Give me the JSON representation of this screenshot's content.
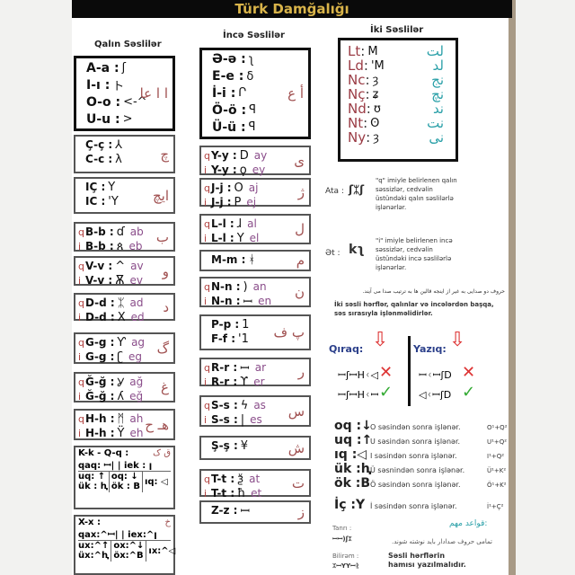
{
  "title": "Türk Damğalığı",
  "headers": {
    "qalin": "Qalın Səslilər",
    "ince": "İncə Səslilər",
    "iki": "İki Səslilər"
  },
  "left_boxes": [
    {
      "thick": true,
      "big": true,
      "lines": [
        {
          "p": "",
          "l": "A-a :",
          "g": "ʃ",
          "s": ""
        },
        {
          "p": "",
          "l": "I-ı  :",
          "g": "ト",
          "s": ""
        },
        {
          "p": "",
          "l": "O-o :",
          "g": "<-^",
          "s": ""
        },
        {
          "p": "",
          "l": "U-u :",
          "g": ">",
          "s": ""
        }
      ],
      "ar": "ا ا عا"
    },
    {
      "lines": [
        {
          "p": "",
          "l": "Ç-ç :",
          "g": "⅄",
          "s": ""
        },
        {
          "p": "",
          "l": "C-c :",
          "g": "λ",
          "s": ""
        }
      ],
      "ar": "چ"
    },
    {
      "lines": [
        {
          "p": "",
          "l": "IÇ :",
          "g": "Y",
          "s": ""
        },
        {
          "p": "",
          "l": "IC :",
          "g": "'Y",
          "s": ""
        }
      ],
      "ar": "ایچ"
    },
    {
      "lines": [
        {
          "p": "q",
          "l": "B-b :",
          "g": "ɗ",
          "s": "ab"
        },
        {
          "p": "i",
          "l": "B-b :",
          "g": "ጰ",
          "s": "eb"
        }
      ],
      "ar": "ب"
    },
    {
      "lines": [
        {
          "p": "q",
          "l": "V-v :",
          "g": "^",
          "s": "av"
        },
        {
          "p": "i",
          "l": "V-v :",
          "g": "Ѫ",
          "s": "ev"
        }
      ],
      "ar": "و"
    },
    {
      "lines": [
        {
          "p": "q",
          "l": "D-d :",
          "g": "ᛯ",
          "s": "ad"
        },
        {
          "p": "i",
          "l": "D-d :",
          "g": "X",
          "s": "ed"
        }
      ],
      "ar": "د"
    },
    {
      "lines": [
        {
          "p": "q",
          "l": "G-g :",
          "g": "Ƴ",
          "s": "ag"
        },
        {
          "p": "i",
          "l": "G-g :",
          "g": "ʗ",
          "s": "eg"
        }
      ],
      "ar": "گ"
    },
    {
      "lines": [
        {
          "p": "q",
          "l": "Ğ-ğ :",
          "g": "Ỿ",
          "s": "ağ"
        },
        {
          "p": "i",
          "l": "Ğ-ğ :",
          "g": "ʎ",
          "s": "eğ"
        }
      ],
      "ar": "غ"
    },
    {
      "lines": [
        {
          "p": "q",
          "l": "H-h :",
          "g": "ᛗ",
          "s": "ah"
        },
        {
          "p": "i",
          "l": "H-h :",
          "g": "Ϋ",
          "s": "eh"
        }
      ],
      "ar": "هـ ح"
    }
  ],
  "kq": {
    "title": "K-k - Q-q :",
    "ar": "ق ک",
    "aq": "qaq: ꟷ|",
    "iek": "iek : ꞁ",
    "uq": "uq: ↑",
    "oq": "oq: ↓",
    "iq": "ıq: ◁",
    "uk": "ük : ⱨ",
    "ok": "ök : B"
  },
  "x": {
    "title": "X-x  :",
    "ar": "خ",
    "ax": "qax:^ꟷ|",
    "iex": "iex:^ꞁ",
    "ux": "ux:^↑",
    "ox": "ox:^↓",
    "ix": "ıx:^◁",
    "uk": "üx:^ⱨ",
    "ok": "öx:^B"
  },
  "mid_boxes": [
    {
      "thick": true,
      "big": true,
      "lines": [
        {
          "p": "",
          "l": "Ə-ə :",
          "g": "ʅ",
          "s": ""
        },
        {
          "p": "",
          "l": "E-e :",
          "g": "ẟ",
          "s": ""
        },
        {
          "p": "",
          "l": "İ-i  :",
          "g": "Ր",
          "s": ""
        },
        {
          "p": "",
          "l": "Ö-ö :",
          "g": "ꟼ",
          "s": ""
        },
        {
          "p": "",
          "l": "Ü-ü :",
          "g": "ꟼ",
          "s": ""
        }
      ],
      "ar": "أ ع"
    },
    {
      "lines": [
        {
          "p": "q",
          "l": "Y-y :",
          "g": "D",
          "s": "ay"
        },
        {
          "p": "i",
          "l": "Y-y :",
          "g": "ϙ",
          "s": "ey"
        }
      ],
      "ar": "ی"
    },
    {
      "lines": [
        {
          "p": "q",
          "l": "J-j  :",
          "g": "O",
          "s": "aj"
        },
        {
          "p": "i",
          "l": "J-j  :",
          "g": "P",
          "s": "ej"
        }
      ],
      "ar": "ژ"
    },
    {
      "lines": [
        {
          "p": "q",
          "l": "L-l  :",
          "g": "ɺ",
          "s": "al"
        },
        {
          "p": "i",
          "l": "L-l  :",
          "g": "Y",
          "s": "el"
        }
      ],
      "ar": "ل"
    },
    {
      "lines": [
        {
          "p": "",
          "l": "M-m :",
          "g": "ᚼ",
          "s": ""
        }
      ],
      "ar": "م"
    },
    {
      "lines": [
        {
          "p": "q",
          "l": "N-n  :",
          "g": ")",
          "s": "an"
        },
        {
          "p": "i",
          "l": "N-n  :",
          "g": "ꟷ",
          "s": "en"
        }
      ],
      "ar": "ن"
    },
    {
      "lines": [
        {
          "p": "",
          "l": "P-p :",
          "g": "1",
          "s": ""
        },
        {
          "p": "",
          "l": "F-f  :",
          "g": "'1",
          "s": ""
        }
      ],
      "ar": "پ ف"
    },
    {
      "lines": [
        {
          "p": "q",
          "l": "R-r  :",
          "g": "ꟷ",
          "s": "ar"
        },
        {
          "p": "i",
          "l": "R-r  :",
          "g": "ϒ",
          "s": "er"
        }
      ],
      "ar": "ر"
    },
    {
      "lines": [
        {
          "p": "q",
          "l": "S-s  :",
          "g": "ϟ",
          "s": "as"
        },
        {
          "p": "i",
          "l": "S-s  :",
          "g": "|",
          "s": "es"
        }
      ],
      "ar": "س"
    },
    {
      "lines": [
        {
          "p": "",
          "l": "Ş-ş  :",
          "g": "¥",
          "s": ""
        }
      ],
      "ar": "ش"
    },
    {
      "lines": [
        {
          "p": "q",
          "l": "T-t  :",
          "g": "ѯ",
          "s": "at"
        },
        {
          "p": "i",
          "l": "T-t  :",
          "g": "ħ",
          "s": "et"
        }
      ],
      "ar": "ت"
    },
    {
      "lines": [
        {
          "p": "",
          "l": "Z-z :",
          "g": "ꟷ",
          "s": ""
        }
      ],
      "ar": "ز"
    }
  ],
  "iki": [
    {
      "l": "Lt",
      "g": "M",
      "ar": "لت"
    },
    {
      "l": "Ld",
      "g": "'M",
      "ar": "لد"
    },
    {
      "l": "Nc",
      "g": "ȝ",
      "ar": "نج"
    },
    {
      "l": "Nç",
      "g": "ʑ",
      "ar": "نچ"
    },
    {
      "l": "Nd",
      "g": "ʊ",
      "ar": "ند"
    },
    {
      "l": "Nt",
      "g": "ʘ",
      "ar": "نت"
    },
    {
      "l": "Ny",
      "g": "ȝ",
      "ar": "نی"
    }
  ],
  "notes": {
    "ata_label": "Ata :",
    "ata_runes": "ʃᛯʃ",
    "ata_text": "\"q\" imiyle belirlenen qalın səssizlər, cedvəlin üstündəki qalın səslilərlə işlənərlər.",
    "et_label": "Ət :",
    "et_runes": "kʅ",
    "et_text": "\"i\" imiyle belirlenen incə səssizlər, cedvəlin üstündəki incə səslilərlə işlənərlər.",
    "arabic_line": "حروف دو صدایی به غیر از اینجه قالین ها به ترتیب صدا می آیند.",
    "iki_text": "İki səsli hərflər, qalınlar və incələrdən başqa, səs sırasıyla işlənməlidirlər."
  },
  "qiraq": {
    "label": "Qıraq:",
    "wrong": "ꟷʃꟷHᚲ◁",
    "right": "ꟷʃꟷHᚲꟷ"
  },
  "yaziq": {
    "label": "Yazıq:",
    "wrong": "ꟷᚲꟷʃD",
    "right": "◁ᚲꟷʃD"
  },
  "rules": [
    {
      "k": "oq :",
      "g": "↓",
      "d": "O səsindən sonra işlənər.",
      "f": "O¹+Q²"
    },
    {
      "k": "uq :",
      "g": "↑",
      "d": "U səsindən sonra işlənər.",
      "f": "U¹+Q²"
    },
    {
      "k": "ıq :",
      "g": "◁",
      "d": "I səsindən sonra işlənər.",
      "f": "I¹+Q²"
    },
    {
      "k": "ük :",
      "g": "ⱨ",
      "d": "Ü səsnindən sonra işlənər.",
      "f": "Ü¹+K²"
    },
    {
      "k": "ök :",
      "g": "B",
      "d": "Ö səsindən sonra işlənər.",
      "f": "Ö¹+K²"
    },
    {
      "k": "İç :",
      "g": "Y",
      "d": "İ səsindən sonra işlənər.",
      "f": "İ¹+Ç²"
    }
  ],
  "footer": {
    "tanri_label": "Tanrı :",
    "tanri_runes": "ꟷꟷ)ʃᛯ",
    "bilirem_label": "Bilirəm :",
    "bilirem_runes": "ᛯꟷYYꟷᚱ",
    "important_ar": "قواعد مهم:",
    "ar_note": "تمامی حروف صدادار باید نوشته شوند.",
    "note": "Səsli hərflərin hamısı yazılmalıdır."
  },
  "colors": {
    "title": "#d9b44a",
    "q_prefix": "#b0403e",
    "sound": "#8a4d8a",
    "arabic": "#a05050",
    "iki_arabic": "#2aa0a8",
    "cross": "#dd3333",
    "check": "#33aa33",
    "qiraq": "#2b3f8a"
  }
}
